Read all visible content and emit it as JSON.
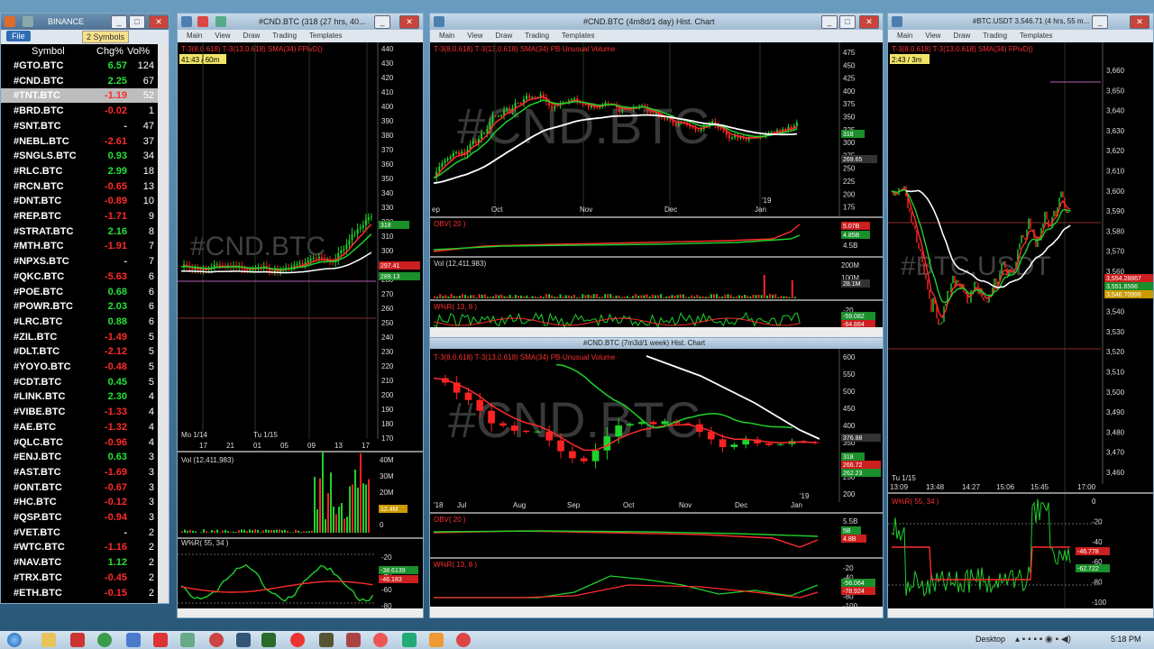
{
  "watchlist": {
    "title": "BINANCE",
    "file_label": "File",
    "symbols_label": "2 Symbols",
    "col_symbol": "Symbol",
    "col_chg": "Chg%",
    "col_vol": "Vol%",
    "rows": [
      {
        "sym": "#GTO.BTC",
        "chg": "6.57",
        "vol": "124",
        "pos": true
      },
      {
        "sym": "#CND.BTC",
        "chg": "2.25",
        "vol": "67",
        "pos": true
      },
      {
        "sym": "#TNT.BTC",
        "chg": "-1.19",
        "vol": "52",
        "pos": false
      },
      {
        "sym": "#BRD.BTC",
        "chg": "-0.02",
        "vol": "1",
        "pos": false
      },
      {
        "sym": "#SNT.BTC",
        "chg": "-",
        "vol": "47",
        "pos": true
      },
      {
        "sym": "#NEBL.BTC",
        "chg": "-2.61",
        "vol": "37",
        "pos": false
      },
      {
        "sym": "#SNGLS.BTC",
        "chg": "0.93",
        "vol": "34",
        "pos": true
      },
      {
        "sym": "#RLC.BTC",
        "chg": "2.99",
        "vol": "18",
        "pos": true
      },
      {
        "sym": "#RCN.BTC",
        "chg": "-0.65",
        "vol": "13",
        "pos": false
      },
      {
        "sym": "#DNT.BTC",
        "chg": "-0.89",
        "vol": "10",
        "pos": false
      },
      {
        "sym": "#REP.BTC",
        "chg": "-1.71",
        "vol": "9",
        "pos": false
      },
      {
        "sym": "#STRAT.BTC",
        "chg": "2.16",
        "vol": "8",
        "pos": true
      },
      {
        "sym": "#MTH.BTC",
        "chg": "-1.91",
        "vol": "7",
        "pos": false
      },
      {
        "sym": "#NPXS.BTC",
        "chg": "-",
        "vol": "7",
        "pos": true
      },
      {
        "sym": "#QKC.BTC",
        "chg": "-5.63",
        "vol": "6",
        "pos": false
      },
      {
        "sym": "#POE.BTC",
        "chg": "0.68",
        "vol": "6",
        "pos": true
      },
      {
        "sym": "#POWR.BTC",
        "chg": "2.03",
        "vol": "6",
        "pos": true
      },
      {
        "sym": "#LRC.BTC",
        "chg": "0.88",
        "vol": "6",
        "pos": true
      },
      {
        "sym": "#ZIL.BTC",
        "chg": "-1.49",
        "vol": "5",
        "pos": false
      },
      {
        "sym": "#DLT.BTC",
        "chg": "-2.12",
        "vol": "5",
        "pos": false
      },
      {
        "sym": "#YOYO.BTC",
        "chg": "-0.48",
        "vol": "5",
        "pos": false
      },
      {
        "sym": "#CDT.BTC",
        "chg": "0.45",
        "vol": "5",
        "pos": true
      },
      {
        "sym": "#LINK.BTC",
        "chg": "2.30",
        "vol": "4",
        "pos": true
      },
      {
        "sym": "#VIBE.BTC",
        "chg": "-1.33",
        "vol": "4",
        "pos": false
      },
      {
        "sym": "#AE.BTC",
        "chg": "-1.32",
        "vol": "4",
        "pos": false
      },
      {
        "sym": "#QLC.BTC",
        "chg": "-0.96",
        "vol": "4",
        "pos": false
      },
      {
        "sym": "#ENJ.BTC",
        "chg": "0.63",
        "vol": "3",
        "pos": true
      },
      {
        "sym": "#AST.BTC",
        "chg": "-1.69",
        "vol": "3",
        "pos": false
      },
      {
        "sym": "#ONT.BTC",
        "chg": "-0.67",
        "vol": "3",
        "pos": false
      },
      {
        "sym": "#HC.BTC",
        "chg": "-0.12",
        "vol": "3",
        "pos": false
      },
      {
        "sym": "#QSP.BTC",
        "chg": "-0.94",
        "vol": "3",
        "pos": false
      },
      {
        "sym": "#VET.BTC",
        "chg": "-",
        "vol": "2",
        "pos": true
      },
      {
        "sym": "#WTC.BTC",
        "chg": "-1.16",
        "vol": "2",
        "pos": false
      },
      {
        "sym": "#NAV.BTC",
        "chg": "1.12",
        "vol": "2",
        "pos": true
      },
      {
        "sym": "#TRX.BTC",
        "chg": "-0.45",
        "vol": "2",
        "pos": false
      },
      {
        "sym": "#ETH.BTC",
        "chg": "-0.15",
        "vol": "2",
        "pos": false
      }
    ]
  },
  "menu": {
    "main": "Main",
    "view": "View",
    "draw": "Draw",
    "trading": "Trading",
    "templates": "Templates"
  },
  "chart1": {
    "title": "#CND.BTC (318 (27 hrs, 40...",
    "indicators": "T-3(8,0.618)  T-3(13,0.618)  SMA(34)  FPivD()",
    "timer": "41:43 / 60m",
    "watermark": "#CND.BTC",
    "price_ticks": [
      "440",
      "430",
      "420",
      "410",
      "400",
      "390",
      "380",
      "370",
      "360",
      "350",
      "340",
      "330",
      "320",
      "310",
      "300",
      "290",
      "280",
      "270",
      "260",
      "250",
      "240",
      "230",
      "220",
      "210",
      "200",
      "190",
      "180",
      "170"
    ],
    "last1": "318",
    "last2": "297.41",
    "last3": "289.13",
    "date_row1": "Mo 1/14",
    "date_row1b": "Tu 1/15",
    "date_ticks": [
      "17",
      "21",
      "01",
      "05",
      "09",
      "13",
      "17"
    ],
    "vol_label": "Vol (12,411,983)",
    "vol_ticks": [
      "40M",
      "30M",
      "20M",
      "10M",
      "0"
    ],
    "vol_last": "12.4M",
    "wr_label": "W%R( 55, 34 )",
    "wr_ticks": [
      "-20",
      "-40",
      "-60",
      "-80",
      "-100"
    ],
    "wr_last1": "-38.6139",
    "wr_last2": "-46.183"
  },
  "chart2": {
    "title": "#CND.BTC (4m8d/1 day) Hist. Chart",
    "indicators": "T-3(8,0.618)  T-3(13,0.618)  SMA(34)  PB-Unusual Volume",
    "watermark": "#CND.BTC",
    "price_ticks": [
      "475",
      "450",
      "425",
      "400",
      "375",
      "350",
      "325",
      "300",
      "275",
      "250",
      "225",
      "200",
      "175"
    ],
    "last1": "318",
    "last2": "269.65",
    "months": [
      "ep",
      "Oct",
      "Nov",
      "Dec",
      "Jan"
    ],
    "yr": "'19",
    "obv_label": "OBV( 20 )",
    "obv_ticks": [
      "4.5B"
    ],
    "obv_last1": "5.07B",
    "obv_last2": "4.85B",
    "vol_label": "Vol (12,411,983)",
    "vol_ticks": [
      "200M",
      "100M"
    ],
    "vol_last": "28.1M",
    "wr_label": "W%R( 13, 8 )",
    "wr_ticks": [
      "-20",
      "-80"
    ],
    "wr_last1": "-64.884",
    "wr_last2": "-59.082"
  },
  "chart3": {
    "title": "#CND.BTC (7m3d/1 week) Hist. Chart",
    "indicators": "T-3(8,0.618)  T-3(13,0.618)  SMA(34)  PB-Unusual Volume",
    "watermark": "#CND.BTC",
    "price_ticks": [
      "600",
      "550",
      "500",
      "450",
      "400",
      "350",
      "300",
      "250",
      "200"
    ],
    "last1": "376.88",
    "last2": "318",
    "last3": "266.72",
    "last4": "262.23",
    "months": [
      "'18",
      "Jul",
      "Aug",
      "Sep",
      "Oct",
      "Nov",
      "Dec",
      "Jan"
    ],
    "yr": "'19",
    "obv_label": "OBV( 20 )",
    "obv_ticks": [
      "5.5B"
    ],
    "obv_last1": "5B",
    "obv_last2": "4.8B",
    "wr_label": "W%R( 13, 8 )",
    "wr_ticks": [
      "-20",
      "-40",
      "-60",
      "-80",
      "-100"
    ],
    "wr_last1": "-56.064",
    "wr_last2": "-78.924"
  },
  "chart4": {
    "title": "#BTC.USDT 3,546.71 (4 hrs, 55 m...",
    "indicators": "T-3(8,0.618)  T-3(13,0.618)  SMA(34)  FPivD()",
    "timer": "2:43 / 3m",
    "watermark": "#BTC.USDT",
    "price_ticks": [
      "3,660",
      "3,650",
      "3,640",
      "3,630",
      "3,620",
      "3,610",
      "3,600",
      "3,590",
      "3,580",
      "3,570",
      "3,560",
      "3,550",
      "3,540",
      "3,530",
      "3,520",
      "3,510",
      "3,500",
      "3,490",
      "3,480",
      "3,470",
      "3,460"
    ],
    "last1": "3,554.28867",
    "last2": "3,551.6566",
    "last3": "3,546.70996",
    "date_row1": "Tu 1/15",
    "time_ticks": [
      "13:09",
      "13:48",
      "14:27",
      "15:06",
      "15:45",
      "17:00"
    ],
    "wr_label": "W%R( 55, 34 )",
    "wr_ticks": [
      "0",
      "-20",
      "-40",
      "-60",
      "-80",
      "-100"
    ],
    "wr_last1": "-46.778",
    "wr_last2": "-62.722"
  },
  "taskbar": {
    "desktop": "Desktop",
    "time": "5:18 PM"
  }
}
